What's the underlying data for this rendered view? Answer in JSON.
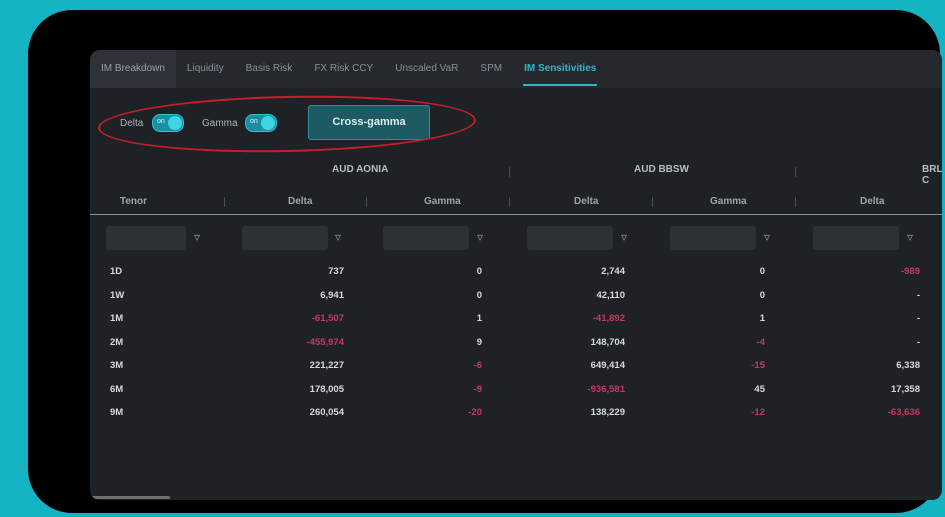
{
  "tabs": [
    {
      "label": "IM Breakdown"
    },
    {
      "label": "Liquidity"
    },
    {
      "label": "Basis Risk"
    },
    {
      "label": "FX Risk CCY"
    },
    {
      "label": "Unscaled VaR"
    },
    {
      "label": "SPM"
    },
    {
      "label": "IM Sensitivities"
    }
  ],
  "active_tab": "IM Sensitivities",
  "toggles": {
    "delta": {
      "label": "Delta",
      "state": "on"
    },
    "gamma": {
      "label": "Gamma",
      "state": "on"
    }
  },
  "cross_gamma_button": "Cross-gamma",
  "annotation_color": "#c81e2a",
  "groups": [
    "AUD AONIA",
    "AUD BBSW",
    "BRL C"
  ],
  "columns": [
    "Tenor",
    "Delta",
    "Gamma",
    "Delta",
    "Gamma",
    "Delta"
  ],
  "rows": [
    {
      "tenor": "1D",
      "v": [
        "737",
        "0",
        "2,744",
        "0",
        "-989"
      ],
      "neg": [
        false,
        false,
        false,
        false,
        true
      ]
    },
    {
      "tenor": "1W",
      "v": [
        "6,941",
        "0",
        "42,110",
        "0",
        "-"
      ],
      "neg": [
        false,
        false,
        false,
        false,
        false
      ]
    },
    {
      "tenor": "1M",
      "v": [
        "-61,507",
        "1",
        "-41,892",
        "1",
        "-"
      ],
      "neg": [
        true,
        false,
        true,
        false,
        false
      ]
    },
    {
      "tenor": "2M",
      "v": [
        "-455,974",
        "9",
        "148,704",
        "-4",
        "-"
      ],
      "neg": [
        true,
        false,
        false,
        true,
        false
      ]
    },
    {
      "tenor": "3M",
      "v": [
        "221,227",
        "-6",
        "649,414",
        "-15",
        "6,338"
      ],
      "neg": [
        false,
        true,
        false,
        true,
        false
      ]
    },
    {
      "tenor": "6M",
      "v": [
        "178,005",
        "-9",
        "-936,581",
        "45",
        "17,358"
      ],
      "neg": [
        false,
        true,
        true,
        false,
        false
      ]
    },
    {
      "tenor": "9M",
      "v": [
        "260,054",
        "-20",
        "138,229",
        "-12",
        "-63,636"
      ],
      "neg": [
        false,
        true,
        false,
        true,
        true
      ]
    }
  ],
  "colors": {
    "accent": "#2bb6c9",
    "negative": "#c23a5e",
    "background": "#14b4c4"
  }
}
